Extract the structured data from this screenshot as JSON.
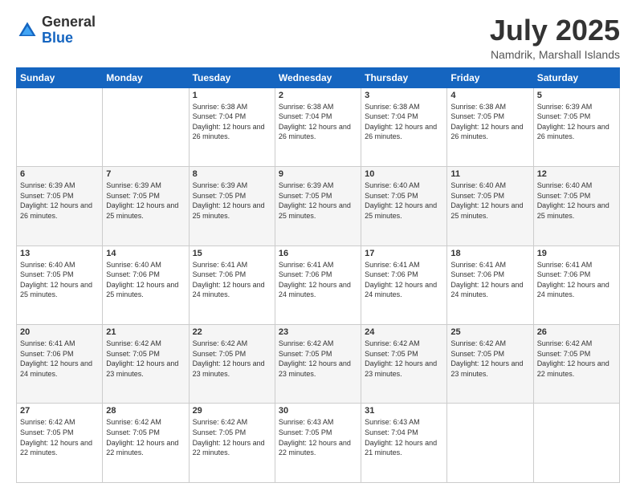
{
  "header": {
    "logo_general": "General",
    "logo_blue": "Blue",
    "month_title": "July 2025",
    "location": "Namdrik, Marshall Islands"
  },
  "weekdays": [
    "Sunday",
    "Monday",
    "Tuesday",
    "Wednesday",
    "Thursday",
    "Friday",
    "Saturday"
  ],
  "weeks": [
    [
      {
        "day": "",
        "sunrise": "",
        "sunset": "",
        "daylight": ""
      },
      {
        "day": "",
        "sunrise": "",
        "sunset": "",
        "daylight": ""
      },
      {
        "day": "1",
        "sunrise": "Sunrise: 6:38 AM",
        "sunset": "Sunset: 7:04 PM",
        "daylight": "Daylight: 12 hours and 26 minutes."
      },
      {
        "day": "2",
        "sunrise": "Sunrise: 6:38 AM",
        "sunset": "Sunset: 7:04 PM",
        "daylight": "Daylight: 12 hours and 26 minutes."
      },
      {
        "day": "3",
        "sunrise": "Sunrise: 6:38 AM",
        "sunset": "Sunset: 7:04 PM",
        "daylight": "Daylight: 12 hours and 26 minutes."
      },
      {
        "day": "4",
        "sunrise": "Sunrise: 6:38 AM",
        "sunset": "Sunset: 7:05 PM",
        "daylight": "Daylight: 12 hours and 26 minutes."
      },
      {
        "day": "5",
        "sunrise": "Sunrise: 6:39 AM",
        "sunset": "Sunset: 7:05 PM",
        "daylight": "Daylight: 12 hours and 26 minutes."
      }
    ],
    [
      {
        "day": "6",
        "sunrise": "Sunrise: 6:39 AM",
        "sunset": "Sunset: 7:05 PM",
        "daylight": "Daylight: 12 hours and 26 minutes."
      },
      {
        "day": "7",
        "sunrise": "Sunrise: 6:39 AM",
        "sunset": "Sunset: 7:05 PM",
        "daylight": "Daylight: 12 hours and 25 minutes."
      },
      {
        "day": "8",
        "sunrise": "Sunrise: 6:39 AM",
        "sunset": "Sunset: 7:05 PM",
        "daylight": "Daylight: 12 hours and 25 minutes."
      },
      {
        "day": "9",
        "sunrise": "Sunrise: 6:39 AM",
        "sunset": "Sunset: 7:05 PM",
        "daylight": "Daylight: 12 hours and 25 minutes."
      },
      {
        "day": "10",
        "sunrise": "Sunrise: 6:40 AM",
        "sunset": "Sunset: 7:05 PM",
        "daylight": "Daylight: 12 hours and 25 minutes."
      },
      {
        "day": "11",
        "sunrise": "Sunrise: 6:40 AM",
        "sunset": "Sunset: 7:05 PM",
        "daylight": "Daylight: 12 hours and 25 minutes."
      },
      {
        "day": "12",
        "sunrise": "Sunrise: 6:40 AM",
        "sunset": "Sunset: 7:05 PM",
        "daylight": "Daylight: 12 hours and 25 minutes."
      }
    ],
    [
      {
        "day": "13",
        "sunrise": "Sunrise: 6:40 AM",
        "sunset": "Sunset: 7:05 PM",
        "daylight": "Daylight: 12 hours and 25 minutes."
      },
      {
        "day": "14",
        "sunrise": "Sunrise: 6:40 AM",
        "sunset": "Sunset: 7:06 PM",
        "daylight": "Daylight: 12 hours and 25 minutes."
      },
      {
        "day": "15",
        "sunrise": "Sunrise: 6:41 AM",
        "sunset": "Sunset: 7:06 PM",
        "daylight": "Daylight: 12 hours and 24 minutes."
      },
      {
        "day": "16",
        "sunrise": "Sunrise: 6:41 AM",
        "sunset": "Sunset: 7:06 PM",
        "daylight": "Daylight: 12 hours and 24 minutes."
      },
      {
        "day": "17",
        "sunrise": "Sunrise: 6:41 AM",
        "sunset": "Sunset: 7:06 PM",
        "daylight": "Daylight: 12 hours and 24 minutes."
      },
      {
        "day": "18",
        "sunrise": "Sunrise: 6:41 AM",
        "sunset": "Sunset: 7:06 PM",
        "daylight": "Daylight: 12 hours and 24 minutes."
      },
      {
        "day": "19",
        "sunrise": "Sunrise: 6:41 AM",
        "sunset": "Sunset: 7:06 PM",
        "daylight": "Daylight: 12 hours and 24 minutes."
      }
    ],
    [
      {
        "day": "20",
        "sunrise": "Sunrise: 6:41 AM",
        "sunset": "Sunset: 7:06 PM",
        "daylight": "Daylight: 12 hours and 24 minutes."
      },
      {
        "day": "21",
        "sunrise": "Sunrise: 6:42 AM",
        "sunset": "Sunset: 7:05 PM",
        "daylight": "Daylight: 12 hours and 23 minutes."
      },
      {
        "day": "22",
        "sunrise": "Sunrise: 6:42 AM",
        "sunset": "Sunset: 7:05 PM",
        "daylight": "Daylight: 12 hours and 23 minutes."
      },
      {
        "day": "23",
        "sunrise": "Sunrise: 6:42 AM",
        "sunset": "Sunset: 7:05 PM",
        "daylight": "Daylight: 12 hours and 23 minutes."
      },
      {
        "day": "24",
        "sunrise": "Sunrise: 6:42 AM",
        "sunset": "Sunset: 7:05 PM",
        "daylight": "Daylight: 12 hours and 23 minutes."
      },
      {
        "day": "25",
        "sunrise": "Sunrise: 6:42 AM",
        "sunset": "Sunset: 7:05 PM",
        "daylight": "Daylight: 12 hours and 23 minutes."
      },
      {
        "day": "26",
        "sunrise": "Sunrise: 6:42 AM",
        "sunset": "Sunset: 7:05 PM",
        "daylight": "Daylight: 12 hours and 22 minutes."
      }
    ],
    [
      {
        "day": "27",
        "sunrise": "Sunrise: 6:42 AM",
        "sunset": "Sunset: 7:05 PM",
        "daylight": "Daylight: 12 hours and 22 minutes."
      },
      {
        "day": "28",
        "sunrise": "Sunrise: 6:42 AM",
        "sunset": "Sunset: 7:05 PM",
        "daylight": "Daylight: 12 hours and 22 minutes."
      },
      {
        "day": "29",
        "sunrise": "Sunrise: 6:42 AM",
        "sunset": "Sunset: 7:05 PM",
        "daylight": "Daylight: 12 hours and 22 minutes."
      },
      {
        "day": "30",
        "sunrise": "Sunrise: 6:43 AM",
        "sunset": "Sunset: 7:05 PM",
        "daylight": "Daylight: 12 hours and 22 minutes."
      },
      {
        "day": "31",
        "sunrise": "Sunrise: 6:43 AM",
        "sunset": "Sunset: 7:04 PM",
        "daylight": "Daylight: 12 hours and 21 minutes."
      },
      {
        "day": "",
        "sunrise": "",
        "sunset": "",
        "daylight": ""
      },
      {
        "day": "",
        "sunrise": "",
        "sunset": "",
        "daylight": ""
      }
    ]
  ]
}
